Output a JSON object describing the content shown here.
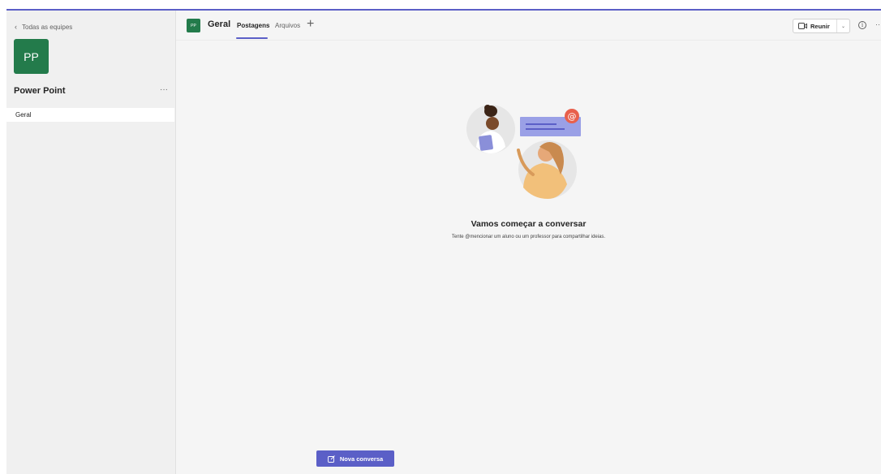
{
  "sidebar": {
    "back_label": "Todas as equipes",
    "team_initials": "PP",
    "team_name": "Power Point",
    "more": "···",
    "channels": [
      {
        "label": "Geral"
      }
    ]
  },
  "header": {
    "channel_initials": "PP",
    "channel_name": "Geral",
    "tabs": [
      {
        "label": "Postagens"
      },
      {
        "label": "Arquivos"
      }
    ],
    "add_tab": "+",
    "meet_label": "Reunir",
    "more": "···"
  },
  "empty_state": {
    "title": "Vamos começar a conversar",
    "subtitle": "Tente @mencionar um aluno ou um professor para compartilhar ideias."
  },
  "new_conversation_label": "Nova conversa",
  "colors": {
    "accent": "#5b5fc7",
    "team_avatar": "#237b4b"
  }
}
